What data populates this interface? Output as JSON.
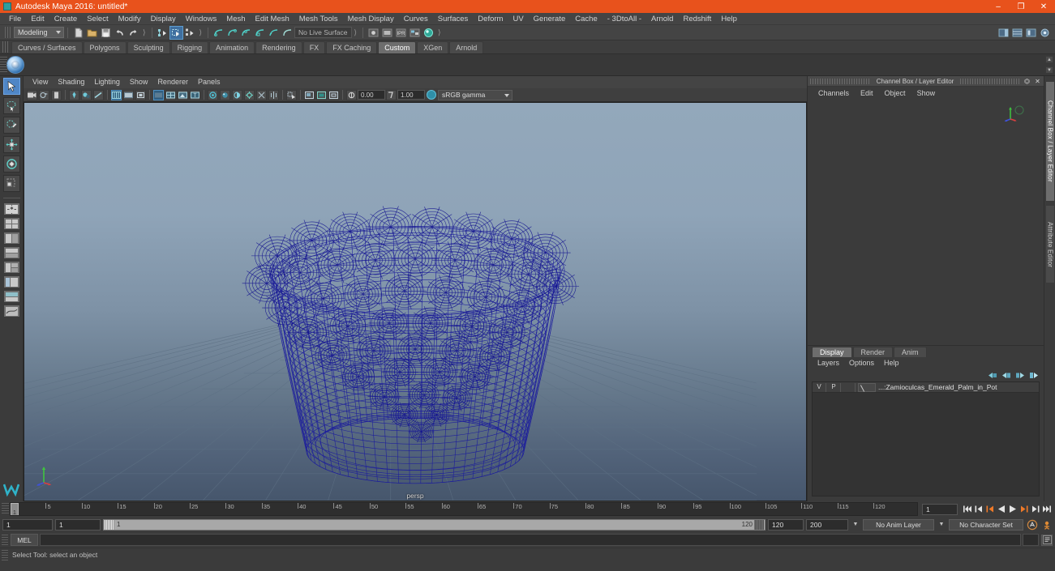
{
  "window": {
    "title": "Autodesk Maya 2016: untitled*",
    "app_icon": "maya-app-icon",
    "minimize": "–",
    "maximize": "❐",
    "close": "✕",
    "titlebar_color": "#e8521c"
  },
  "menubar": {
    "items": [
      "File",
      "Edit",
      "Create",
      "Select",
      "Modify",
      "Display",
      "Windows",
      "Mesh",
      "Edit Mesh",
      "Mesh Tools",
      "Mesh Display",
      "Curves",
      "Surfaces",
      "Deform",
      "UV",
      "Generate",
      "Cache",
      "- 3DtoAll -",
      "Arnold",
      "Redshift",
      "Help"
    ]
  },
  "statusbar": {
    "menu_set": "Modeling",
    "live_surface": "No Live Surface",
    "icons": [
      "new-scene-icon",
      "open-scene-icon",
      "save-scene-icon",
      "undo-icon",
      "redo-icon",
      "select-by-hierarchy-icon",
      "select-by-object-icon",
      "select-by-component-icon",
      "snap-curve-icon",
      "snap-grid-icon",
      "snap-point-icon",
      "snap-projected-icon",
      "snap-view-icon",
      "snap-active-icon",
      "render-view-icon",
      "render-current-icon",
      "ipr-render-icon",
      "render-settings-icon",
      "hypershade-icon"
    ],
    "right_icons": [
      "show-hide-sidebar-icon",
      "channel-box-icon",
      "attribute-editor-icon",
      "tool-settings-icon"
    ]
  },
  "shelf": {
    "tabs": [
      "Curves / Surfaces",
      "Polygons",
      "Sculpting",
      "Rigging",
      "Animation",
      "Rendering",
      "FX",
      "FX Caching",
      "Custom",
      "XGen",
      "Arnold"
    ],
    "selected_tab": "Custom",
    "items": [
      {
        "name": "sphere-shelf-icon"
      }
    ]
  },
  "toolbox": {
    "tools": [
      {
        "name": "select-tool",
        "selected": true
      },
      {
        "name": "lasso-select-tool",
        "selected": false
      },
      {
        "name": "paint-select-tool",
        "selected": false
      },
      {
        "name": "move-tool",
        "selected": false
      },
      {
        "name": "rotate-tool",
        "selected": false
      },
      {
        "name": "scale-tool",
        "selected": false
      },
      {
        "name": "last-tool-used",
        "selected": false
      }
    ],
    "layouts": [
      "single-perspective-layout",
      "four-view-layout",
      "two-pane-side-layout",
      "two-pane-stacked-layout",
      "three-pane-layout",
      "outliner-persp-layout",
      "hypershade-persp-layout",
      "persp-graph-layout"
    ]
  },
  "viewport": {
    "menus": [
      "View",
      "Shading",
      "Lighting",
      "Show",
      "Renderer",
      "Panels"
    ],
    "camera_label": "persp",
    "exposure": "0.00",
    "gamma": "1.00",
    "color_management": "sRGB gamma",
    "tool_icons": [
      "select-camera-icon",
      "bookmark-icon",
      "image-plane-icon",
      "two-sided-lighting-icon",
      "shadows-icon",
      "ao-icon",
      "wireframe-icon",
      "smooth-shade-all-icon",
      "smooth-shade-selected-icon",
      "flat-shade-icon",
      "wireframe-on-shaded-icon",
      "textured-icon",
      "use-default-material-icon",
      "xray-icon",
      "xray-joints-icon",
      "xray-active-components-icon",
      "lights-icon",
      "grid-toggle-icon",
      "film-gate-icon",
      "resolution-gate-icon",
      "gate-mask-icon",
      "exposure-icon",
      "gamma-icon",
      "color-management-icon"
    ],
    "axis_gizmo": {
      "x": "x-axis",
      "y": "y-axis",
      "z": "z-axis"
    },
    "model_color": "#1a1a9e",
    "bg_top": "#93a8bb",
    "bg_bottom": "#46566c"
  },
  "channel_box": {
    "panel_title": "Channel Box / Layer Editor",
    "dock_icon": "undock-icon",
    "close_icon": "close-icon",
    "menus": [
      "Channels",
      "Edit",
      "Object",
      "Show"
    ]
  },
  "layer_editor": {
    "tabs": [
      "Display",
      "Render",
      "Anim"
    ],
    "selected_tab": "Display",
    "menus": [
      "Layers",
      "Options",
      "Help"
    ],
    "buttons": [
      "new-layer-icon",
      "new-layer-from-selected-icon",
      "move-layer-up-icon",
      "move-layer-down-icon"
    ],
    "rows": [
      {
        "visibility": "V",
        "playback": "P",
        "type_swatch": "layer-type-swatch",
        "name": "...:Zamioculcas_Emerald_Palm_in_Pot"
      }
    ]
  },
  "vertical_tabs": {
    "items": [
      "Channel Box / Layer Editor",
      "Attribute Editor"
    ],
    "selected": "Channel Box / Layer Editor"
  },
  "time_slider": {
    "start": 1,
    "end": 120,
    "current_frame": "1",
    "tick_labels": [
      "5",
      "10",
      "15",
      "20",
      "25",
      "30",
      "35",
      "40",
      "45",
      "50",
      "55",
      "60",
      "65",
      "70",
      "75",
      "80",
      "85",
      "90",
      "95",
      "100",
      "105",
      "110",
      "115",
      "120"
    ],
    "playhead_label": "1",
    "playback_controls": [
      "go-to-start-icon",
      "step-back-frame-icon",
      "step-back-key-icon",
      "play-backwards-icon",
      "play-forwards-icon",
      "step-forward-key-icon",
      "step-forward-frame-icon",
      "go-to-end-icon"
    ]
  },
  "range_slider": {
    "anim_start": "1",
    "range_start": "1",
    "range_track_label": "1",
    "range_track_end_label": "120",
    "range_end": "120",
    "anim_end": "200",
    "anim_layer": "No Anim Layer",
    "character_set": "No Character Set",
    "auto_key_icon": "auto-keyframe-icon",
    "anim_prefs_icon": "animation-preferences-icon"
  },
  "command_line": {
    "language_label": "MEL",
    "input_value": "",
    "script_editor_icon": "script-editor-icon"
  },
  "help_line": {
    "text": "Select Tool: select an object"
  }
}
